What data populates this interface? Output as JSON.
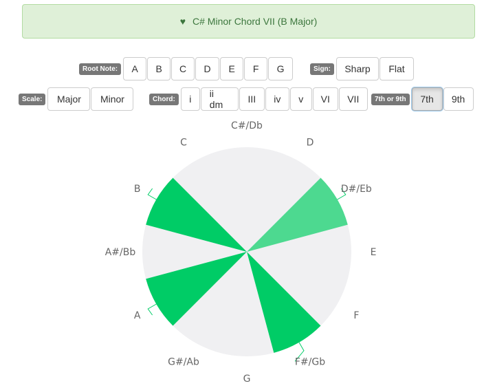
{
  "alert": {
    "icon": "heart-icon",
    "text": "C# Minor Chord VII (B Major)",
    "color": "#3c763d",
    "background": "#dff0d8"
  },
  "root_note": {
    "label": "Root Note:",
    "options": [
      "A",
      "B",
      "C",
      "D",
      "E",
      "F",
      "G"
    ]
  },
  "sign": {
    "label": "Sign:",
    "options": [
      "Sharp",
      "Flat"
    ]
  },
  "scale": {
    "label": "Scale:",
    "options": [
      "Major",
      "Minor"
    ]
  },
  "chord": {
    "label": "Chord:",
    "options": [
      "i",
      "ii dm",
      "III",
      "iv",
      "v",
      "VI",
      "VII"
    ]
  },
  "extension": {
    "label": "7th or 9th",
    "options": [
      "7th",
      "9th"
    ],
    "selected": "7th"
  },
  "wheel": {
    "notes": [
      "C#/Db",
      "D",
      "D#/Eb",
      "E",
      "F",
      "F#/Gb",
      "G",
      "G#/Ab",
      "A",
      "A#/Bb",
      "B",
      "C"
    ],
    "highlighted": [
      {
        "note": "D#/Eb",
        "color": "#4dd990"
      },
      {
        "note": "F#/Gb",
        "color": "#00cc66"
      },
      {
        "note": "A",
        "color": "#00cc66"
      },
      {
        "note": "B",
        "color": "#00cc66"
      }
    ],
    "base_color": "#f0f0f2",
    "leader_color": "#00cc66"
  }
}
